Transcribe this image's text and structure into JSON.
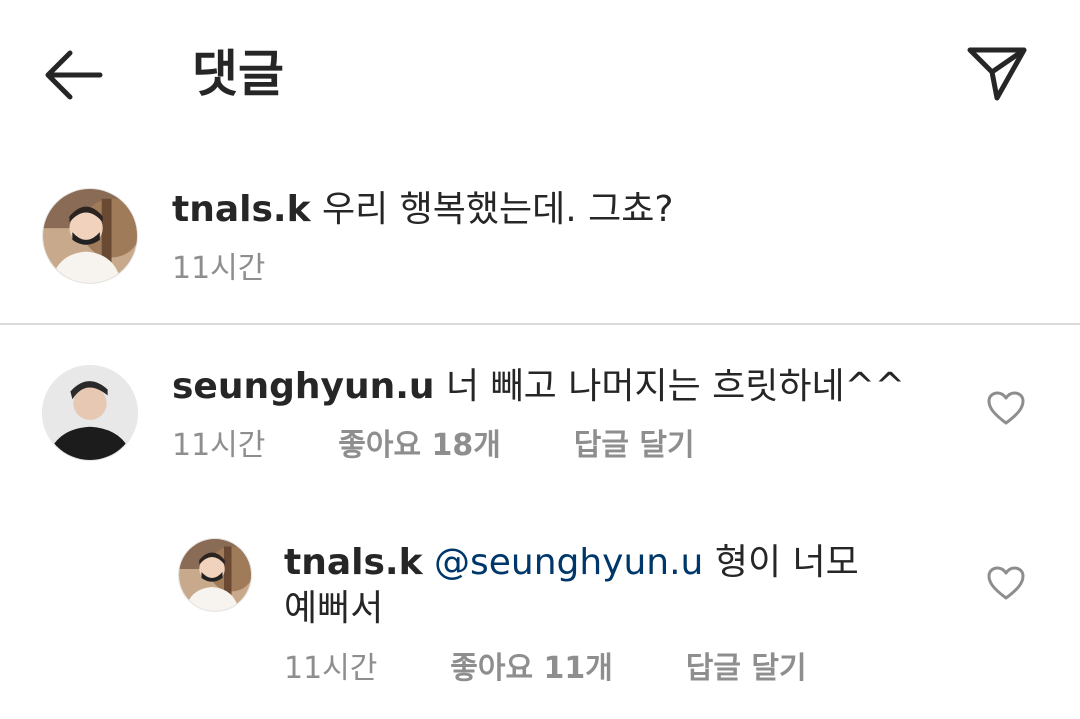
{
  "header": {
    "back_icon": "arrow-left-icon",
    "title": "댓글",
    "share_icon": "paper-plane-icon"
  },
  "caption": {
    "username": "tnals.k",
    "text": "우리 행복했는데. 그쵸?",
    "time": "11시간"
  },
  "comments": [
    {
      "username": "seunghyun.u",
      "text": "너 빼고 나머지는 흐릿하네^^",
      "time": "11시간",
      "likes": "좋아요 18개",
      "reply_label": "답글 달기",
      "like_icon": "heart-outline-icon"
    }
  ],
  "replies": [
    {
      "username": "tnals.k",
      "mention": "@seunghyun.u",
      "text_line1": "형이 너모",
      "text_line2": "예뻐서",
      "time": "11시간",
      "likes": "좋아요 11개",
      "reply_label": "답글 달기",
      "like_icon": "heart-outline-icon"
    }
  ],
  "colors": {
    "text": "#262626",
    "meta": "#8e8e8e",
    "mention": "#00376b",
    "divider": "#dbdbdb"
  }
}
